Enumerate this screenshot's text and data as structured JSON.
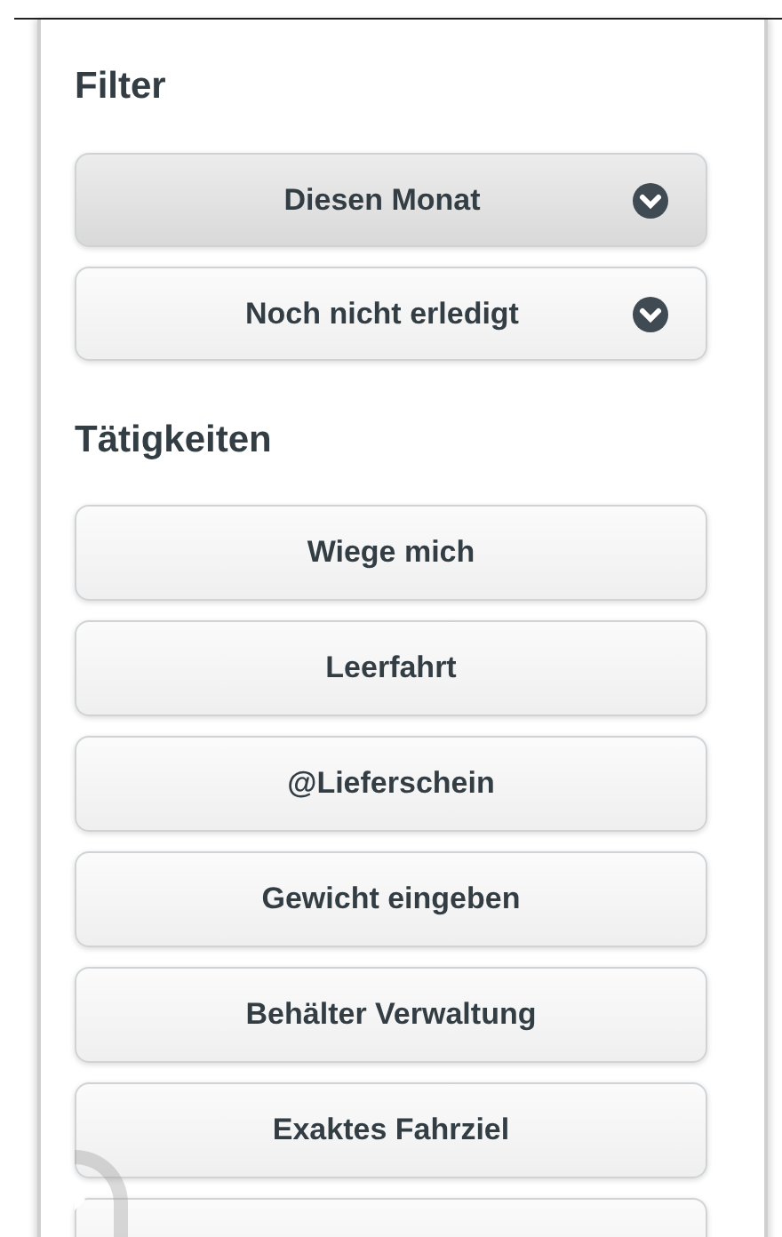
{
  "filter": {
    "heading": "Filter",
    "dropdowns": [
      {
        "label": "Diesen Monat",
        "pressed": true
      },
      {
        "label": "Noch nicht erledigt",
        "pressed": false
      }
    ]
  },
  "activities": {
    "heading": "Tätigkeiten",
    "buttons": [
      {
        "label": "Wiege mich"
      },
      {
        "label": "Leerfahrt"
      },
      {
        "label": "@Lieferschein"
      },
      {
        "label": "Gewicht eingeben"
      },
      {
        "label": "Behälter Verwaltung"
      },
      {
        "label": "Exaktes Fahrziel"
      }
    ]
  }
}
